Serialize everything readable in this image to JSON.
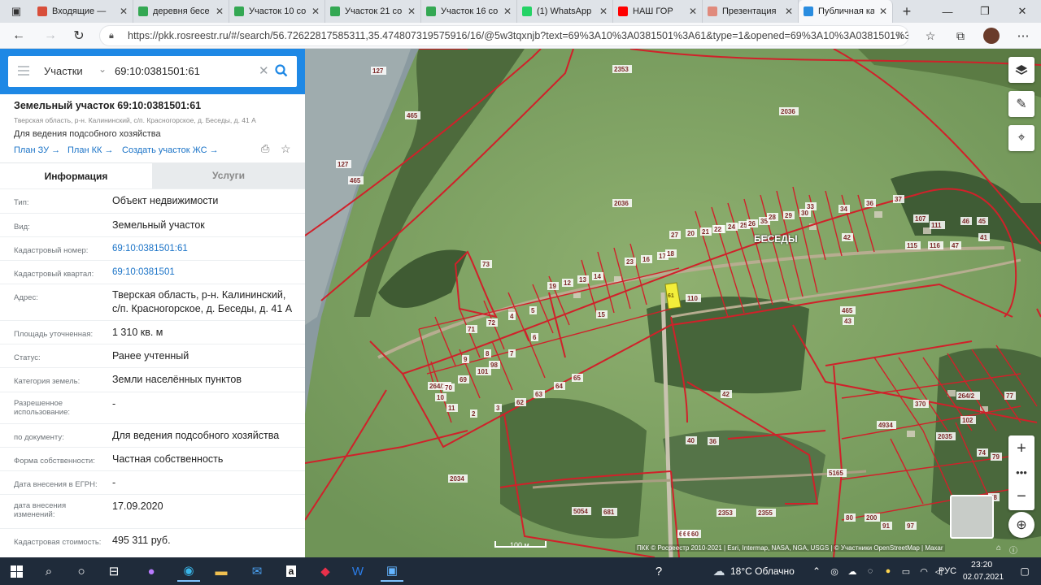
{
  "browser": {
    "tabs": [
      {
        "title": "Входящие — ",
        "color": "#d84e3a"
      },
      {
        "title": "деревня бесе",
        "color": "#34a853"
      },
      {
        "title": "Участок 10 со",
        "color": "#34a853"
      },
      {
        "title": "Участок 21 со",
        "color": "#34a853"
      },
      {
        "title": "Участок 16 со",
        "color": "#34a853"
      },
      {
        "title": "(1) WhatsApp",
        "color": "#25d366"
      },
      {
        "title": "НАШ ГОР",
        "color": "#ff0000"
      },
      {
        "title": "Презентация ",
        "color": "#e08a7c"
      },
      {
        "title": "Публичная ка",
        "color": "#2a8de0"
      }
    ],
    "url": "https://pkk.rosreestr.ru/#/search/56.72622817585311,35.474807319575916/16/@5w3tqxnjb?text=69%3A10%3A0381501%3A61&type=1&opened=69%3A10%3A0381501%3A61"
  },
  "search": {
    "menu_icon": "hamburger-icon",
    "type_label": "Участки",
    "query": "69:10:0381501:61"
  },
  "object": {
    "title": "Земельный участок 69:10:0381501:61",
    "address_small": "Тверская область, р-н. Калининский, с/п. Красногорское, д. Беседы, д. 41 А",
    "purpose": "Для ведения подсобного хозяйства",
    "links": [
      "План ЗУ →",
      "План КК →",
      "Создать участок ЖС →"
    ]
  },
  "tabs": {
    "info": "Информация",
    "services": "Услуги"
  },
  "fields": [
    {
      "label": "Тип:",
      "value": "Объект недвижимости",
      "link": false
    },
    {
      "label": "Вид:",
      "value": "Земельный участок",
      "link": false
    },
    {
      "label": "Кадастровый номер:",
      "value": "69:10:0381501:61",
      "link": true
    },
    {
      "label": "Кадастровый квартал:",
      "value": "69:10:0381501",
      "link": true
    },
    {
      "label": "Адрес:",
      "value": "Тверская область, р-н. Калининский, с/п. Красногорское, д. Беседы, д. 41 А",
      "link": false
    },
    {
      "label": "Площадь уточненная:",
      "value": "1 310 кв. м",
      "link": false
    },
    {
      "label": "Статус:",
      "value": "Ранее учтенный",
      "link": false
    },
    {
      "label": "Категория земель:",
      "value": "Земли населённых пунктов",
      "link": false
    },
    {
      "label": "Разрешенное использование:",
      "value": "-",
      "link": false
    },
    {
      "label": "по документу:",
      "value": "Для ведения подсобного хозяйства",
      "link": false
    },
    {
      "label": "Форма собственности:",
      "value": "Частная собственность",
      "link": false
    },
    {
      "label": "Дата внесения в ЕГРН:",
      "value": "-",
      "link": false
    },
    {
      "label": "дата внесения изменений:",
      "value": "17.09.2020",
      "link": false
    },
    {
      "label": "Кадастровая стоимость:",
      "value": "495 311 руб.",
      "link": false
    }
  ],
  "map": {
    "place_name": "БЕСЕДЫ",
    "selected_parcel": "61",
    "scale_label": "100 м",
    "attribution": "ПКК © Росреестр 2010-2021 | Esri, Intermap, NASA, NGA, USGS | © Участники OpenStreetMap | Maxar",
    "parcel_numbers": [
      "127",
      "465",
      "127",
      "465",
      "2353",
      "2036",
      "2036",
      "73",
      "37",
      "36",
      "33",
      "34",
      "35",
      "28",
      "29",
      "30",
      "31",
      "24",
      "25",
      "26",
      "27",
      "20",
      "21",
      "22",
      "23",
      "16",
      "17",
      "18",
      "19",
      "12",
      "13",
      "14",
      "15",
      "110",
      "107",
      "111",
      "115",
      "116",
      "47",
      "46",
      "45",
      "41",
      "42",
      "43",
      "42",
      "40",
      "36",
      "264/1",
      "2034",
      "5054",
      "681",
      "2353",
      "2355",
      "5165",
      "465",
      "4934",
      "370",
      "264/2",
      "2035",
      "102",
      "74",
      "77",
      "78",
      "79",
      "80",
      "200",
      "91",
      "97",
      "98",
      "101",
      "69",
      "70",
      "71",
      "72",
      "4",
      "5",
      "6",
      "7",
      "8",
      "9",
      "10",
      "11",
      "2",
      "3",
      "62",
      "63",
      "64",
      "65",
      "66",
      "67",
      "68",
      "60"
    ],
    "road_numbers": [
      "2353",
      "264/1",
      "2034"
    ]
  },
  "taskbar": {
    "weather": "18°C  Облачно",
    "lang": "РУС",
    "time": "23:20",
    "date": "02.07.2021"
  },
  "colors": {
    "search_bar": "#1e88e5",
    "parcel_line": "#d0212a",
    "selected_parcel": "#f3ee3a",
    "link": "#1a73c7"
  }
}
